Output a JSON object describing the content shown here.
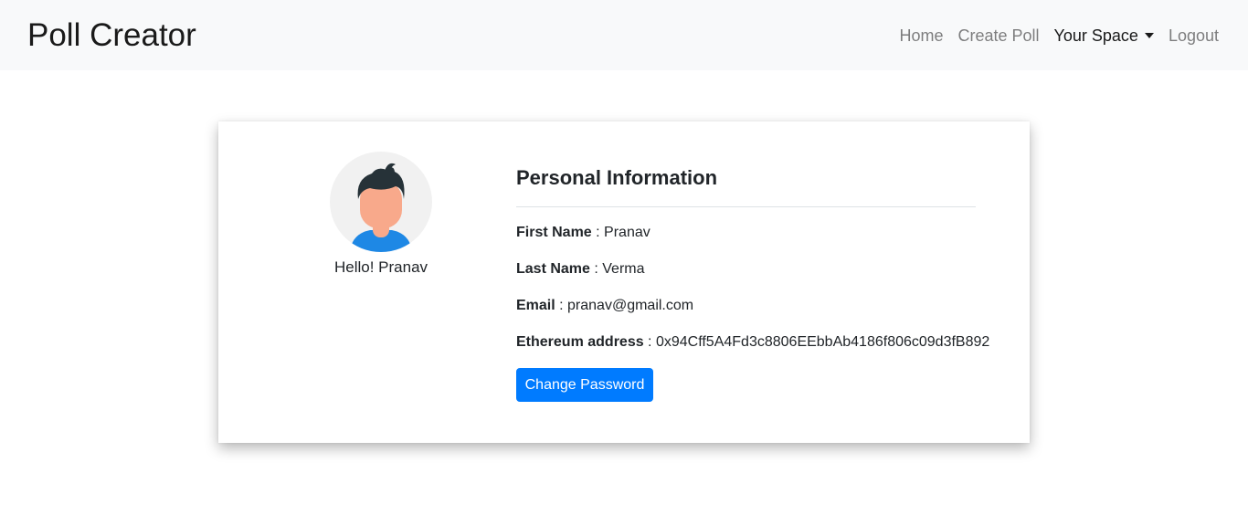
{
  "brand": "Poll Creator",
  "nav": {
    "home": "Home",
    "create_poll": "Create Poll",
    "your_space": "Your Space",
    "logout": "Logout"
  },
  "profile": {
    "greeting": "Hello! Pranav",
    "avatar_icon": "user-avatar-icon"
  },
  "info": {
    "title": "Personal Information",
    "first_name_label": "First Name",
    "first_name": "Pranav",
    "last_name_label": "Last Name",
    "last_name": "Verma",
    "email_label": "Email",
    "email": "pranav@gmail.com",
    "eth_label": "Ethereum address",
    "eth_address": "0x94Cff5A4Fd3c8806EEbbAb4186f806c09d3fB892",
    "separator": " : "
  },
  "actions": {
    "change_password": "Change Password"
  },
  "colors": {
    "primary": "#007bff",
    "navbar_bg": "#f8f9fa"
  }
}
